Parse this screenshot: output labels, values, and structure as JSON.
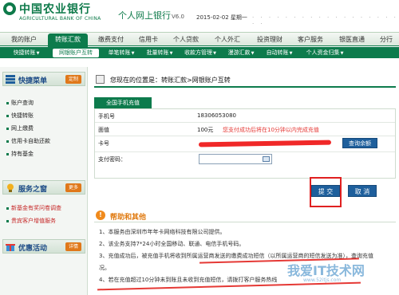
{
  "header": {
    "logo_cn": "中国农业银行",
    "logo_en": "AGRICULTURAL BANK OF CHINA",
    "site_title": "个人网上银行",
    "version": "V6.0",
    "date": "2015-02-02 星期一"
  },
  "main_nav": [
    "我的账户",
    "转账汇款",
    "缴费支付",
    "信用卡",
    "个人贷款",
    "个人外汇",
    "投资理财",
    "客户服务",
    "银医直通",
    "分行"
  ],
  "sub_nav": [
    "快捷转账",
    "网银账户互转",
    "单笔转账",
    "批量转账",
    "收款方管理",
    "漫游汇款",
    "自动转账",
    "个人资金归集"
  ],
  "sidebar": {
    "quick_menu": {
      "title": "快捷菜单",
      "button": "定制",
      "items": [
        "账户查询",
        "快捷转账",
        "网上缴费",
        "信用卡自助还款",
        "持有基金"
      ]
    },
    "service_window": {
      "title": "服务之窗",
      "button": "更多",
      "items": [
        "新基金有奖问卷调查",
        "贵宾客户增值服务"
      ]
    },
    "promotions": {
      "title": "优惠活动",
      "button": "详情"
    }
  },
  "breadcrumb": "您现在的位置是：转账汇款>网银账户互转",
  "form": {
    "tab": "全国手机充值",
    "phone_label": "手机号",
    "phone_value": "18306053080",
    "amount_label": "面值",
    "amount_value": "100元",
    "amount_note": "您支付成功后将在10分钟以内完成充值",
    "card_label": "卡号",
    "query_button": "查询余额",
    "password_label": "支付密码："
  },
  "buttons": {
    "submit": "提 交",
    "cancel": "取 消"
  },
  "help": {
    "title": "帮助和其他",
    "lines": [
      "1、本服务由深圳市年年卡网络科技有限公司提供。",
      "2、该业务支持7*24小时全国移动、联通、电信手机号码。",
      "3、充值成功后，被充值手机将收到所属运营商发送的缴费成功短信（以所属运营商的短信发送为准），查询充值",
      "况。",
      "4、若在充值超过10分钟未到账且未收到充值短信，请拨打客户服务热线"
    ]
  },
  "watermark": {
    "text": "我爱IT技术网",
    "url": "www.52itjs.com"
  },
  "colors": {
    "brand_green": "#0d7b4c",
    "button_blue": "#1e5f9c",
    "alert_red": "#e53935",
    "help_orange": "#e07a10"
  }
}
